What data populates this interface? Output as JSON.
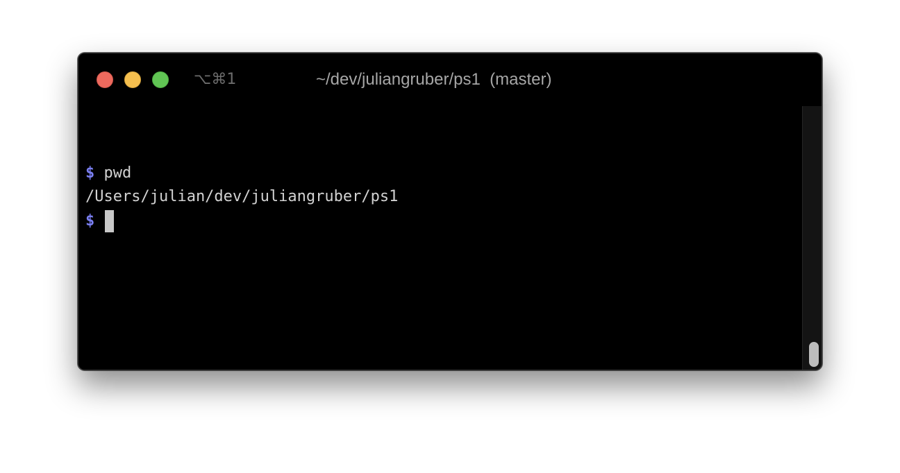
{
  "window": {
    "shortcut": "⌥⌘1",
    "title": "~/dev/juliangruber/ps1  (master)"
  },
  "terminal": {
    "prompt_symbol": "$",
    "lines": [
      {
        "prompt": "$",
        "text": "pwd"
      },
      {
        "prompt": "",
        "text": "/Users/julian/dev/juliangruber/ps1"
      },
      {
        "prompt": "$",
        "text": ""
      }
    ]
  },
  "colors": {
    "prompt": "#7a7ff2",
    "text": "#d2d2d2",
    "background": "#000000",
    "close": "#ed6a5e",
    "minimize": "#f5bf4f",
    "zoom": "#61c554"
  },
  "icons": {
    "close": "close-icon",
    "minimize": "minimize-icon",
    "zoom": "zoom-icon"
  }
}
